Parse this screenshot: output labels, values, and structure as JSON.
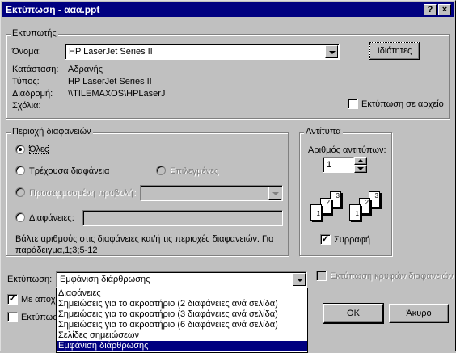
{
  "title_bar": {
    "title": "Εκτύπωση - ααα.ppt",
    "help_glyph": "?",
    "close_glyph": "×"
  },
  "printer": {
    "group_label": "Εκτυπωτής",
    "name_label": "Όνομα:",
    "name_value": "HP LaserJet Series II",
    "status_label": "Κατάσταση:",
    "status_value": "Αδρανής",
    "type_label": "Τύπος:",
    "type_value": "HP LaserJet Series II",
    "path_label": "Διαδρομή:",
    "path_value": "\\\\TILEMAXOS\\HPLaserJ",
    "comments_label": "Σχόλια:",
    "properties_button": "Ιδιότητες",
    "print_to_file_label": "Εκτύπωση σε αρχείο"
  },
  "range": {
    "group_label": "Περιοχή διαφανειών",
    "all_label": "Όλες",
    "current_label": "Τρέχουσα διαφάνεια",
    "selection_label": "Επιλεγμένες",
    "custom_show_label": "Προσαρμοσμένη προβολή:",
    "slides_label": "Διαφάνειες:",
    "slides_value": "",
    "hint": "Βάλτε αριθμούς στις διαφάνειες και/ή τις περιοχές διαφανειών. Για παράδειγμα,1;3;5-12"
  },
  "copies": {
    "group_label": "Αντίτυπα",
    "count_label": "Αριθμός αντιτύπων:",
    "count_value": "1",
    "collate_label": "Συρραφή",
    "collate_icon_page_numbers": [
      "1",
      "2",
      "3"
    ]
  },
  "print_what": {
    "label": "Εκτύπωση:",
    "selected": "Εμφάνιση διάρθρωσης",
    "options": [
      "Διαφάνειες",
      "Σημειώσεις για το ακροατήριο (2 διαφάνειες ανά σελίδα)",
      "Σημειώσεις για το ακροατήριο (3 διαφάνειες ανά σελίδα)",
      "Σημειώσεις για το ακροατήριο (6 διαφάνειες ανά σελίδα)",
      "Σελίδες σημειώσεων",
      "Εμφάνιση διάρθρωσης"
    ],
    "print_hidden_label": "Εκτύπωση κρυφών διαφανειών"
  },
  "bottom_options": {
    "opt1_label_partial": "Με αποχρ",
    "opt2_label_partial": "Εκτύπωσ"
  },
  "buttons": {
    "ok": "OK",
    "cancel": "Άκυρο"
  }
}
